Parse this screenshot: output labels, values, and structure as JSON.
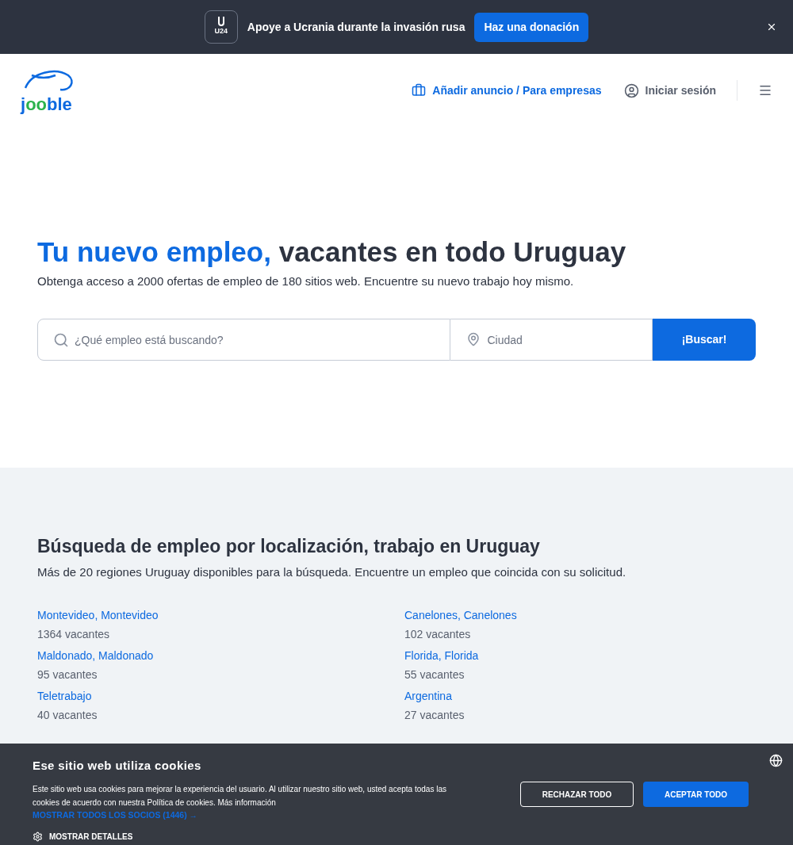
{
  "banner": {
    "badge": "U24",
    "text": "Apoye a Ucrania durante la invasión rusa",
    "button": "Haz una donación"
  },
  "header": {
    "logo": "jooble",
    "post_job": "Añadir anuncio / Para empresas",
    "login": "Iniciar sesión"
  },
  "hero": {
    "title_highlight": "Tu nuevo empleo,",
    "title_rest": "vacantes en todo Uruguay",
    "subtitle": "Obtenga acceso a 2000 ofertas de empleo de 180 sitios web. Encuentre su nuevo trabajo hoy mismo.",
    "search": {
      "placeholder": "¿Qué empleo está buscando?"
    },
    "city": {
      "placeholder": "Ciudad"
    },
    "button": "¡Buscar!"
  },
  "locations": {
    "title": "Búsqueda de empleo por localización, trabajo en Uruguay",
    "subtitle": "Más de 20 regiones Uruguay disponibles para la búsqueda. Encuentre un empleo que coincida con su solicitud.",
    "items": [
      {
        "name": "Montevideo, Montevideo",
        "count": "1364 vacantes"
      },
      {
        "name": "Canelones, Canelones",
        "count": "102 vacantes"
      },
      {
        "name": "Maldonado, Maldonado",
        "count": "95 vacantes"
      },
      {
        "name": "Florida, Florida",
        "count": "55 vacantes"
      },
      {
        "name": "Teletrabajo",
        "count": "40 vacantes"
      },
      {
        "name": "Argentina",
        "count": "27 vacantes"
      }
    ]
  },
  "cookies": {
    "title": "Ese sitio web utiliza cookies",
    "text": "Este sitio web usa cookies para mejorar la experiencia del usuario. Al utilizar nuestro sitio web, usted acepta todas las cookies de acuerdo con nuestra Política de cookies. Más información",
    "partners": "MOSTRAR TODOS LOS SOCIOS (1446) →",
    "details": "MOSTRAR DETALLES",
    "reject": "RECHAZAR TODO",
    "accept": "ACEPTAR TODO"
  }
}
